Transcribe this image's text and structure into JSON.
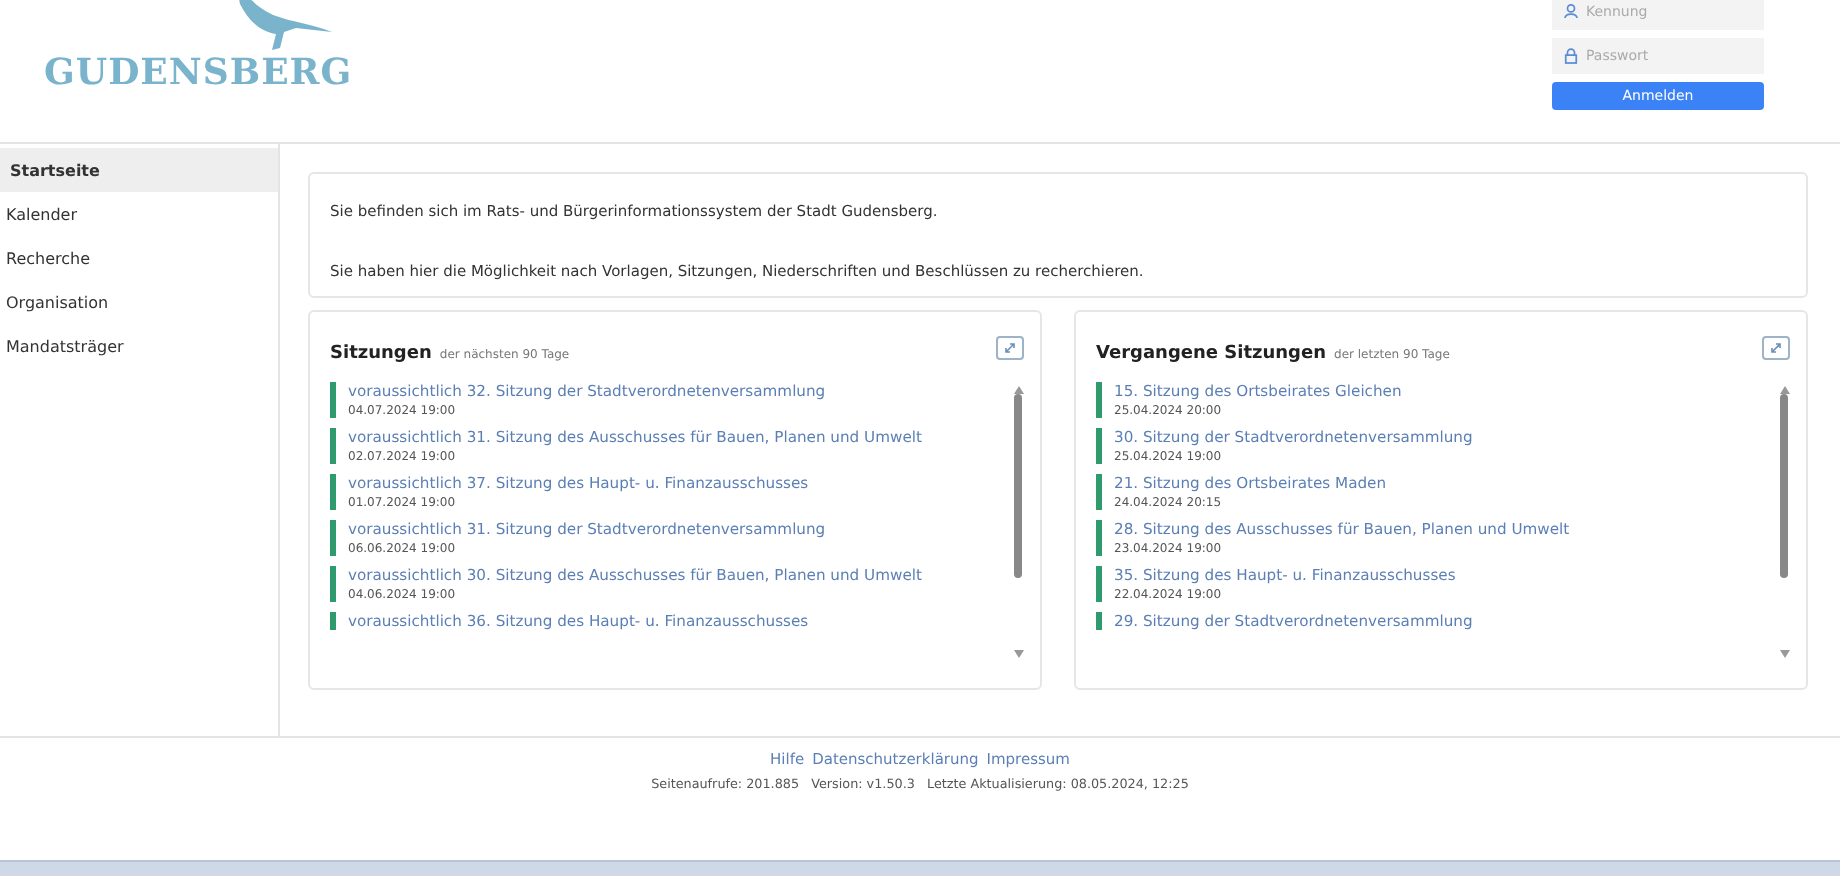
{
  "logo": {
    "text": "GUDENSBERG"
  },
  "login": {
    "user_placeholder": "Kennung",
    "password_placeholder": "Passwort",
    "button": "Anmelden"
  },
  "nav": [
    {
      "label": "Startseite",
      "selected": true
    },
    {
      "label": "Kalender",
      "selected": false
    },
    {
      "label": "Recherche",
      "selected": false
    },
    {
      "label": "Organisation",
      "selected": false
    },
    {
      "label": "Mandatsträger",
      "selected": false
    }
  ],
  "intro": [
    "Sie befinden sich im Rats- und Bürgerinformationssystem der Stadt Gudensberg.",
    "Sie haben hier die Möglichkeit nach Vorlagen, Sitzungen, Niederschriften und Beschlüssen zu recherchieren."
  ],
  "panels": [
    {
      "title": "Sitzungen",
      "subtitle": "der nächsten 90 Tage",
      "items": [
        {
          "title": "voraussichtlich 32. Sitzung der Stadtverordnetenversammlung",
          "date": "04.07.2024 19:00"
        },
        {
          "title": "voraussichtlich 31. Sitzung des Ausschusses für Bauen, Planen und Umwelt",
          "date": "02.07.2024 19:00"
        },
        {
          "title": "voraussichtlich 37. Sitzung des Haupt- u. Finanzausschusses",
          "date": "01.07.2024 19:00"
        },
        {
          "title": "voraussichtlich 31. Sitzung der Stadtverordnetenversammlung",
          "date": "06.06.2024 19:00"
        },
        {
          "title": "voraussichtlich 30. Sitzung des Ausschusses für Bauen, Planen und Umwelt",
          "date": "04.06.2024 19:00"
        },
        {
          "title": "voraussichtlich 36. Sitzung des Haupt- u. Finanzausschusses"
        }
      ]
    },
    {
      "title": "Vergangene Sitzungen",
      "subtitle": "der letzten 90 Tage",
      "items": [
        {
          "title": "15. Sitzung des Ortsbeirates Gleichen",
          "date": "25.04.2024 20:00"
        },
        {
          "title": "30. Sitzung der Stadtverordnetenversammlung",
          "date": "25.04.2024 19:00"
        },
        {
          "title": "21. Sitzung des Ortsbeirates Maden",
          "date": "24.04.2024 20:15"
        },
        {
          "title": "28. Sitzung des Ausschusses für Bauen, Planen und Umwelt",
          "date": "23.04.2024 19:00"
        },
        {
          "title": "35. Sitzung des Haupt- u. Finanzausschusses",
          "date": "22.04.2024 19:00"
        },
        {
          "title": "29. Sitzung der Stadtverordnetenversammlung"
        }
      ]
    }
  ],
  "footer": {
    "links": [
      "Hilfe",
      "Datenschutzerklärung",
      "Impressum"
    ],
    "info": "Seitenaufrufe: 201.885   Version: v1.50.3   Letzte Aktualisierung: 08.05.2024, 12:25"
  }
}
